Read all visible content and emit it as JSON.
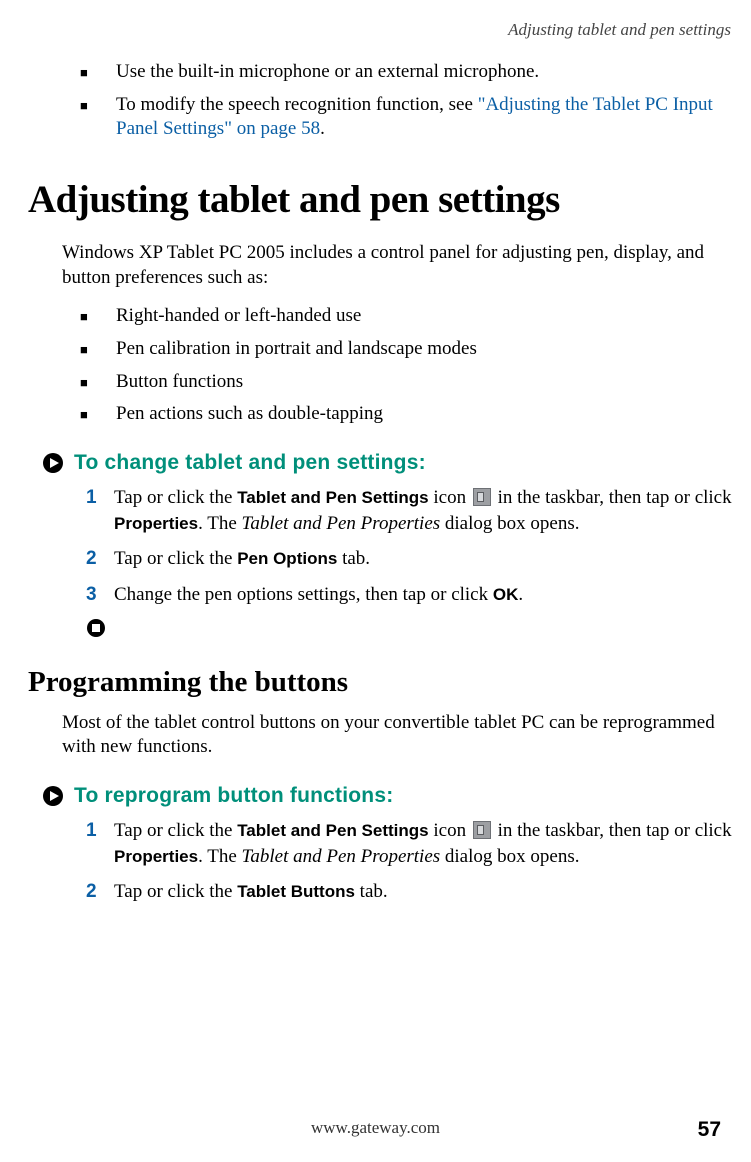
{
  "running_head": "Adjusting tablet and pen settings",
  "intro_bullets": [
    {
      "text_before": "Use the built-in microphone or an external microphone.",
      "link": "",
      "text_after": ""
    },
    {
      "text_before": "To modify the speech recognition function, see ",
      "link": "\"Adjusting the Tablet PC Input Panel Settings\" on page 58",
      "text_after": "."
    }
  ],
  "h1": "Adjusting tablet and pen settings",
  "h1_intro": "Windows XP Tablet PC 2005 includes a control panel for adjusting pen, display, and button preferences such as:",
  "h1_bullets": [
    "Right-handed or left-handed use",
    "Pen calibration in portrait and landscape modes",
    "Button functions",
    "Pen actions such as double-tapping"
  ],
  "proc1_header": "To change tablet and pen settings:",
  "proc1_steps": {
    "s1_a": "Tap or click the ",
    "s1_b": "Tablet and Pen Settings",
    "s1_c": " icon ",
    "s1_d": " in the taskbar, then tap or click ",
    "s1_e": "Properties",
    "s1_f": ". The ",
    "s1_g": "Tablet and Pen Properties",
    "s1_h": " dialog box opens.",
    "s2_a": "Tap or click the ",
    "s2_b": "Pen Options",
    "s2_c": " tab.",
    "s3_a": "Change the pen options settings, then tap or click ",
    "s3_b": "OK",
    "s3_c": "."
  },
  "h2": "Programming the buttons",
  "h2_intro": "Most of the tablet control buttons on your convertible tablet PC can be reprogrammed with new functions.",
  "proc2_header": "To reprogram button functions:",
  "proc2_steps": {
    "s1_a": "Tap or click the ",
    "s1_b": "Tablet and Pen Settings",
    "s1_c": " icon ",
    "s1_d": " in the taskbar, then tap or click ",
    "s1_e": "Properties",
    "s1_f": ". The ",
    "s1_g": "Tablet and Pen Properties",
    "s1_h": " dialog box opens.",
    "s2_a": "Tap or click the ",
    "s2_b": "Tablet Buttons",
    "s2_c": " tab."
  },
  "footer_url": "www.gateway.com",
  "page_number": "57"
}
